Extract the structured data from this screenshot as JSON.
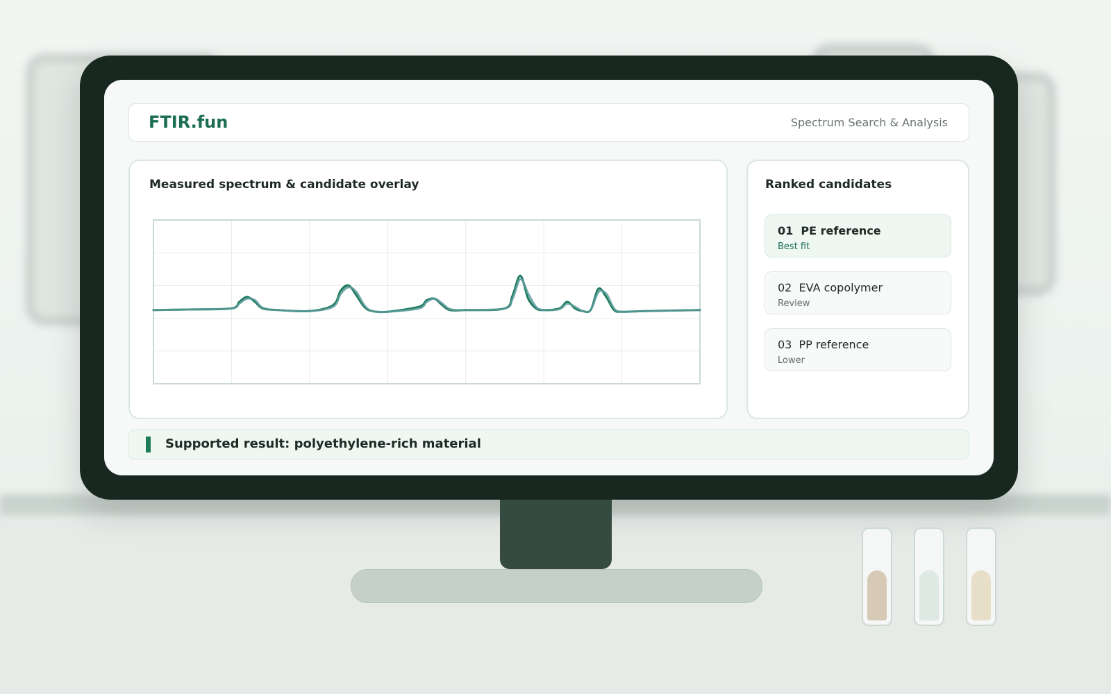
{
  "app": {
    "brand": "FTIR.fun",
    "subtitle": "Spectrum Search & Analysis"
  },
  "chart": {
    "title": "Measured spectrum & candidate overlay",
    "colors": {
      "measured": "#1b7a5c",
      "candidate": "#5a9a9a",
      "grid": "#e6ebe9",
      "frame": "#ccd8d4"
    }
  },
  "chart_data": {
    "type": "line",
    "title": "Measured spectrum & candidate overlay",
    "xlabel": "",
    "ylabel": "",
    "xlim": [
      0,
      7
    ],
    "ylim": [
      0,
      5
    ],
    "grid": true,
    "series": [
      {
        "x": [
          0,
          0.5,
          1,
          1.1,
          1.2,
          1.3,
          1.4,
          1.6,
          2,
          2.3,
          2.4,
          2.5,
          2.6,
          2.7,
          2.8,
          3,
          3.4,
          3.5,
          3.6,
          3.7,
          3.8,
          4,
          4.5,
          4.6,
          4.7,
          4.8,
          4.9,
          5,
          5.2,
          5.3,
          5.4,
          5.5,
          5.6,
          5.7,
          5.8,
          5.9,
          6,
          6.3,
          7
        ],
        "values": [
          2.25,
          2.27,
          2.3,
          2.5,
          2.65,
          2.5,
          2.3,
          2.25,
          2.22,
          2.4,
          2.85,
          3.0,
          2.7,
          2.35,
          2.22,
          2.2,
          2.35,
          2.55,
          2.6,
          2.4,
          2.25,
          2.25,
          2.3,
          2.7,
          3.3,
          2.6,
          2.3,
          2.25,
          2.3,
          2.5,
          2.3,
          2.22,
          2.25,
          2.9,
          2.65,
          2.25,
          2.2,
          2.22,
          2.25
        ]
      },
      {
        "x": [
          0,
          0.5,
          1,
          1.1,
          1.2,
          1.3,
          1.4,
          1.6,
          2,
          2.3,
          2.4,
          2.5,
          2.6,
          2.7,
          2.8,
          3,
          3.4,
          3.5,
          3.6,
          3.7,
          3.8,
          4,
          4.5,
          4.6,
          4.7,
          4.8,
          4.9,
          5,
          5.2,
          5.3,
          5.4,
          5.5,
          5.6,
          5.7,
          5.8,
          5.9,
          6,
          6.3,
          7
        ],
        "values": [
          2.25,
          2.27,
          2.3,
          2.45,
          2.6,
          2.55,
          2.32,
          2.25,
          2.22,
          2.35,
          2.75,
          2.95,
          2.8,
          2.4,
          2.22,
          2.2,
          2.3,
          2.5,
          2.6,
          2.45,
          2.28,
          2.25,
          2.3,
          2.6,
          3.2,
          2.75,
          2.35,
          2.25,
          2.28,
          2.45,
          2.35,
          2.22,
          2.25,
          2.8,
          2.75,
          2.3,
          2.2,
          2.22,
          2.25
        ]
      }
    ]
  },
  "candidates": {
    "title": "Ranked candidates",
    "items": [
      {
        "name": "01  PE reference",
        "status": "Best fit"
      },
      {
        "name": "02  EVA copolymer",
        "status": "Review"
      },
      {
        "name": "03  PP reference",
        "status": "Lower"
      }
    ]
  },
  "result": {
    "text": "Supported result: polyethylene-rich material",
    "accent": "#1b7a57"
  }
}
